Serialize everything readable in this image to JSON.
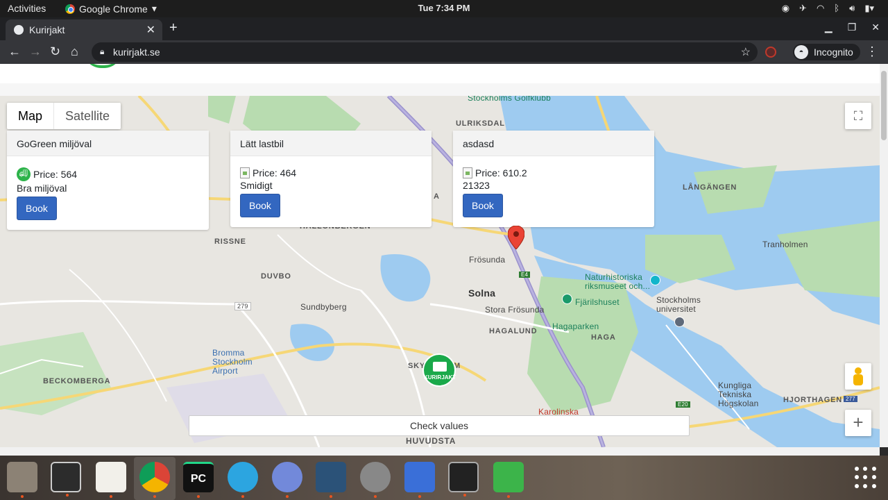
{
  "topbar": {
    "activities": "Activities",
    "app_name": "Google Chrome",
    "clock": "Tue  7:34 PM"
  },
  "browser": {
    "tab_title": "Kurirjakt",
    "url": "kurirjakt.se",
    "incognito_label": "Incognito"
  },
  "map": {
    "type_buttons": [
      "Map",
      "Satellite"
    ],
    "labels": {
      "ulriksdal": "ULRIKSDAL",
      "hallonbergen": "HALLONBERGEN",
      "rissne": "RISSNE",
      "duvbo": "DUVBO",
      "frosunda": "Frösunda",
      "solna": "Solna",
      "stora_frosunda": "Stora Frösunda",
      "hagalund": "HAGALUND",
      "sundbyberg": "Sundbyberg",
      "bromma_airport": "Bromma Stockholm Airport",
      "beckomberga": "BECKOMBERGA",
      "huvudsta": "HUVUDSTA",
      "naturhistoriska": "Naturhistoriska riksmuseet och...",
      "fjarilshuset": "Fjärilshuset",
      "hagaparken": "Hagaparken",
      "haga": "HAGA",
      "stockholms_universitet": "Stockholms universitet",
      "tranholmen": "Tranholmen",
      "langangen": "LÅNGÄNGEN",
      "kth": "Kungliga Tekniska Högskolan",
      "hjorthagen": "HJORTHAGEN",
      "karolinska": "Karolinska",
      "golfklubb": "Stockholms Golfklubb",
      "sky": "SKY",
      "m_suffix": "M",
      "a_label": "A",
      "route_279": "279",
      "route_e4": "E4",
      "route_e20": "E20",
      "route_277": "277"
    },
    "logo_text": "KURIRJAKT"
  },
  "cards": [
    {
      "title": "GoGreen miljöval",
      "price_label": "Price: 564",
      "description": "Bra miljöval",
      "button": "Book"
    },
    {
      "title": "Lätt lastbil",
      "price_label": "Price: 464",
      "description": "Smidigt",
      "button": "Book"
    },
    {
      "title": "asdasd",
      "price_label": "Price: 610.2",
      "description": "21323",
      "button": "Book"
    }
  ],
  "check_values_label": "Check values",
  "dock": {
    "apps": [
      "files-icon",
      "terminal-icon",
      "text-editor-icon",
      "chrome-icon",
      "pycharm-icon",
      "telegram-icon",
      "discord-icon",
      "mysql-workbench-icon",
      "settings-icon",
      "vpn-lock-icon",
      "system-monitor-icon",
      "turtle-app-icon"
    ],
    "pycharm_text": "PC"
  }
}
